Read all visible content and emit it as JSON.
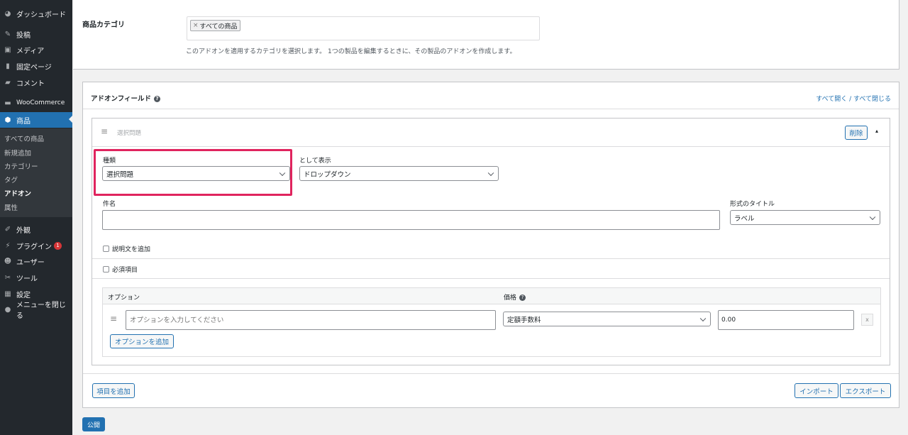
{
  "sidebar": {
    "menu": [
      {
        "label": "ダッシュボード",
        "icon": "dashboard-icon"
      },
      {
        "label": "投稿",
        "icon": "pin-icon"
      },
      {
        "label": "メディア",
        "icon": "media-icon"
      },
      {
        "label": "固定ページ",
        "icon": "page-icon"
      },
      {
        "label": "コメント",
        "icon": "comment-icon"
      },
      {
        "label": "WooCommerce",
        "icon": "woocommerce-icon"
      },
      {
        "label": "商品",
        "icon": "product-icon"
      }
    ],
    "submenu": [
      "すべての商品",
      "新規追加",
      "カテゴリー",
      "タグ",
      "アドオン",
      "属性"
    ],
    "menu2": [
      {
        "label": "外観",
        "icon": "brush-icon"
      },
      {
        "label": "プラグイン",
        "icon": "plugin-icon",
        "badge": "1"
      },
      {
        "label": "ユーザー",
        "icon": "user-icon"
      },
      {
        "label": "ツール",
        "icon": "wrench-icon"
      },
      {
        "label": "設定",
        "icon": "settings-icon"
      },
      {
        "label": "メニューを閉じる",
        "icon": "collapse-icon"
      }
    ]
  },
  "category": {
    "label": "商品カテゴリ",
    "tag": "すべての商品",
    "tag_remove": "×",
    "description": "このアドオンを適用するカテゴリを選択します。 1つの製品を編集するときに、その製品のアドオンを作成します。"
  },
  "addon_fields": {
    "title": "アドオンフィールド",
    "help": "?",
    "toggle_all": "すべて開く / すべて閉じる",
    "field": {
      "header_title": "選択問題",
      "delete": "削除",
      "collapse": "▴",
      "type_label": "種類",
      "type_value": "選択問題",
      "display_label": "として表示",
      "display_value": "ドロップダウン",
      "name_label": "件名",
      "name_value": "",
      "format_label": "形式のタイトル",
      "format_value": "ラベル",
      "add_description": "説明文を追加",
      "required": "必須項目",
      "options_header": "オプション",
      "price_header": "価格",
      "option_placeholder": "オプションを入力してください",
      "price_type": "定額手数料",
      "price_value": "0.00",
      "remove_option": "x",
      "add_option": "オプションを追加"
    },
    "add_field": "項目を追加",
    "import": "インポート",
    "export": "エクスポート"
  },
  "publish": "公開",
  "colors": {
    "highlight": "#e0245e",
    "accent": "#2271b1"
  }
}
